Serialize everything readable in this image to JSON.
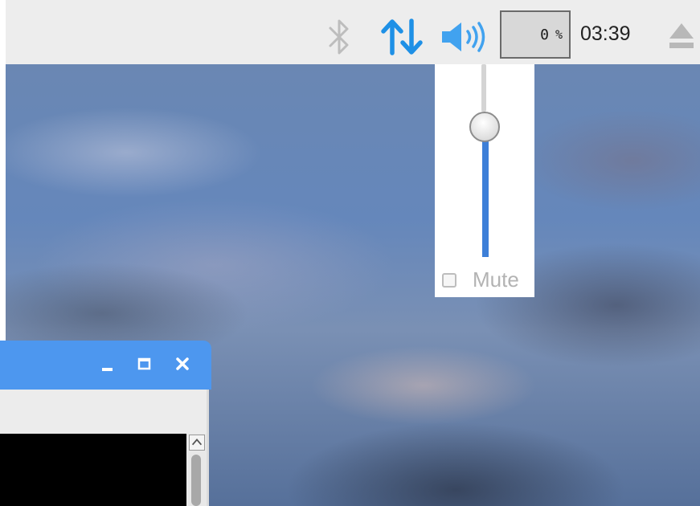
{
  "taskbar": {
    "cpu_value": "0",
    "cpu_unit": "%",
    "clock": "03:39",
    "icons": [
      "bluetooth-icon",
      "network-icon",
      "volume-icon",
      "eject-icon"
    ],
    "colors": {
      "accent": "#1e90e6",
      "inactive": "#bdbdbd"
    }
  },
  "volume_popup": {
    "level_percent": 70,
    "mute_label": "Mute",
    "muted": false
  },
  "window": {
    "title_color": "#4d97ef",
    "controls": [
      "minimize-icon",
      "maximize-icon",
      "close-icon"
    ]
  }
}
